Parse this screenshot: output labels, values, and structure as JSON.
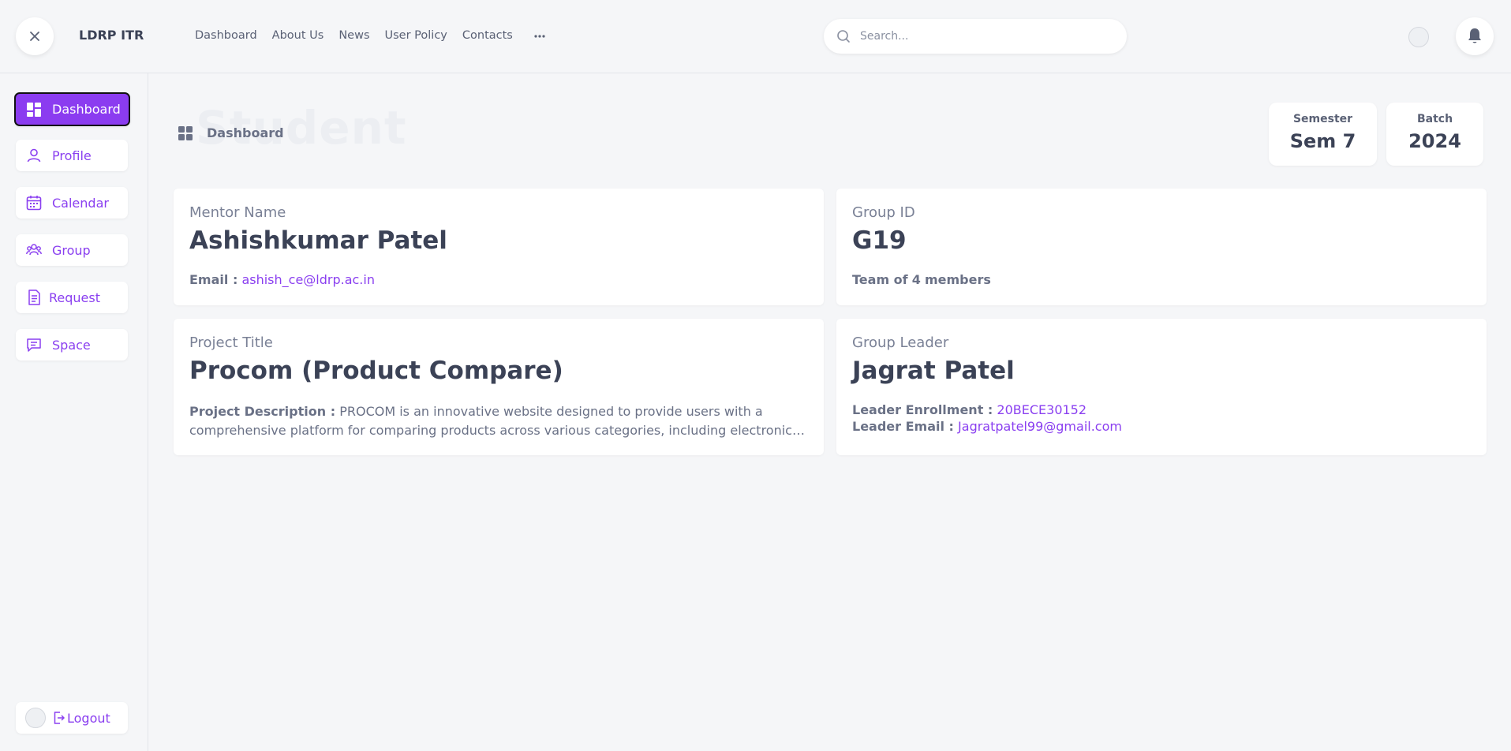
{
  "header": {
    "brand": "LDRP ITR",
    "nav": [
      "Dashboard",
      "About Us",
      "News",
      "User Policy",
      "Contacts"
    ],
    "search_placeholder": "Search..."
  },
  "sidebar": {
    "items": [
      {
        "label": "Dashboard",
        "icon": "grid-icon"
      },
      {
        "label": "Profile",
        "icon": "user-icon"
      },
      {
        "label": "Calendar",
        "icon": "calendar-icon"
      },
      {
        "label": "Group",
        "icon": "group-icon"
      },
      {
        "label": "Request",
        "icon": "document-icon"
      },
      {
        "label": "Space",
        "icon": "chat-icon"
      }
    ],
    "logout_label": "Logout"
  },
  "page": {
    "ghost_title": "Student",
    "breadcrumb": "Dashboard",
    "stats": [
      {
        "label": "Semester",
        "value": "Sem 7"
      },
      {
        "label": "Batch",
        "value": "2024"
      }
    ]
  },
  "cards": {
    "mentor": {
      "key": "Mentor Name",
      "value": "Ashishkumar Patel",
      "email_label": "Email :",
      "email": "ashish_ce@ldrp.ac.in"
    },
    "group": {
      "key": "Group ID",
      "value": "G19",
      "team_prefix": "Team of",
      "team_count": "4",
      "team_suffix": "members"
    },
    "project": {
      "key": "Project Title",
      "value": "Procom (Product Compare)",
      "desc_label": "Project Description :",
      "desc": "PROCOM is an innovative website designed to provide users with a comprehensive platform for comparing products across various categories, including electronics, appliances, and more."
    },
    "leader": {
      "key": "Group Leader",
      "value": "Jagrat Patel",
      "enroll_label": "Leader Enrollment :",
      "enroll": "20BECE30152",
      "email_label": "Leader Email :",
      "email": "Jagratpatel99@gmail.com"
    }
  },
  "colors": {
    "accent": "#8b3cf0",
    "background": "#f5f6f8"
  }
}
